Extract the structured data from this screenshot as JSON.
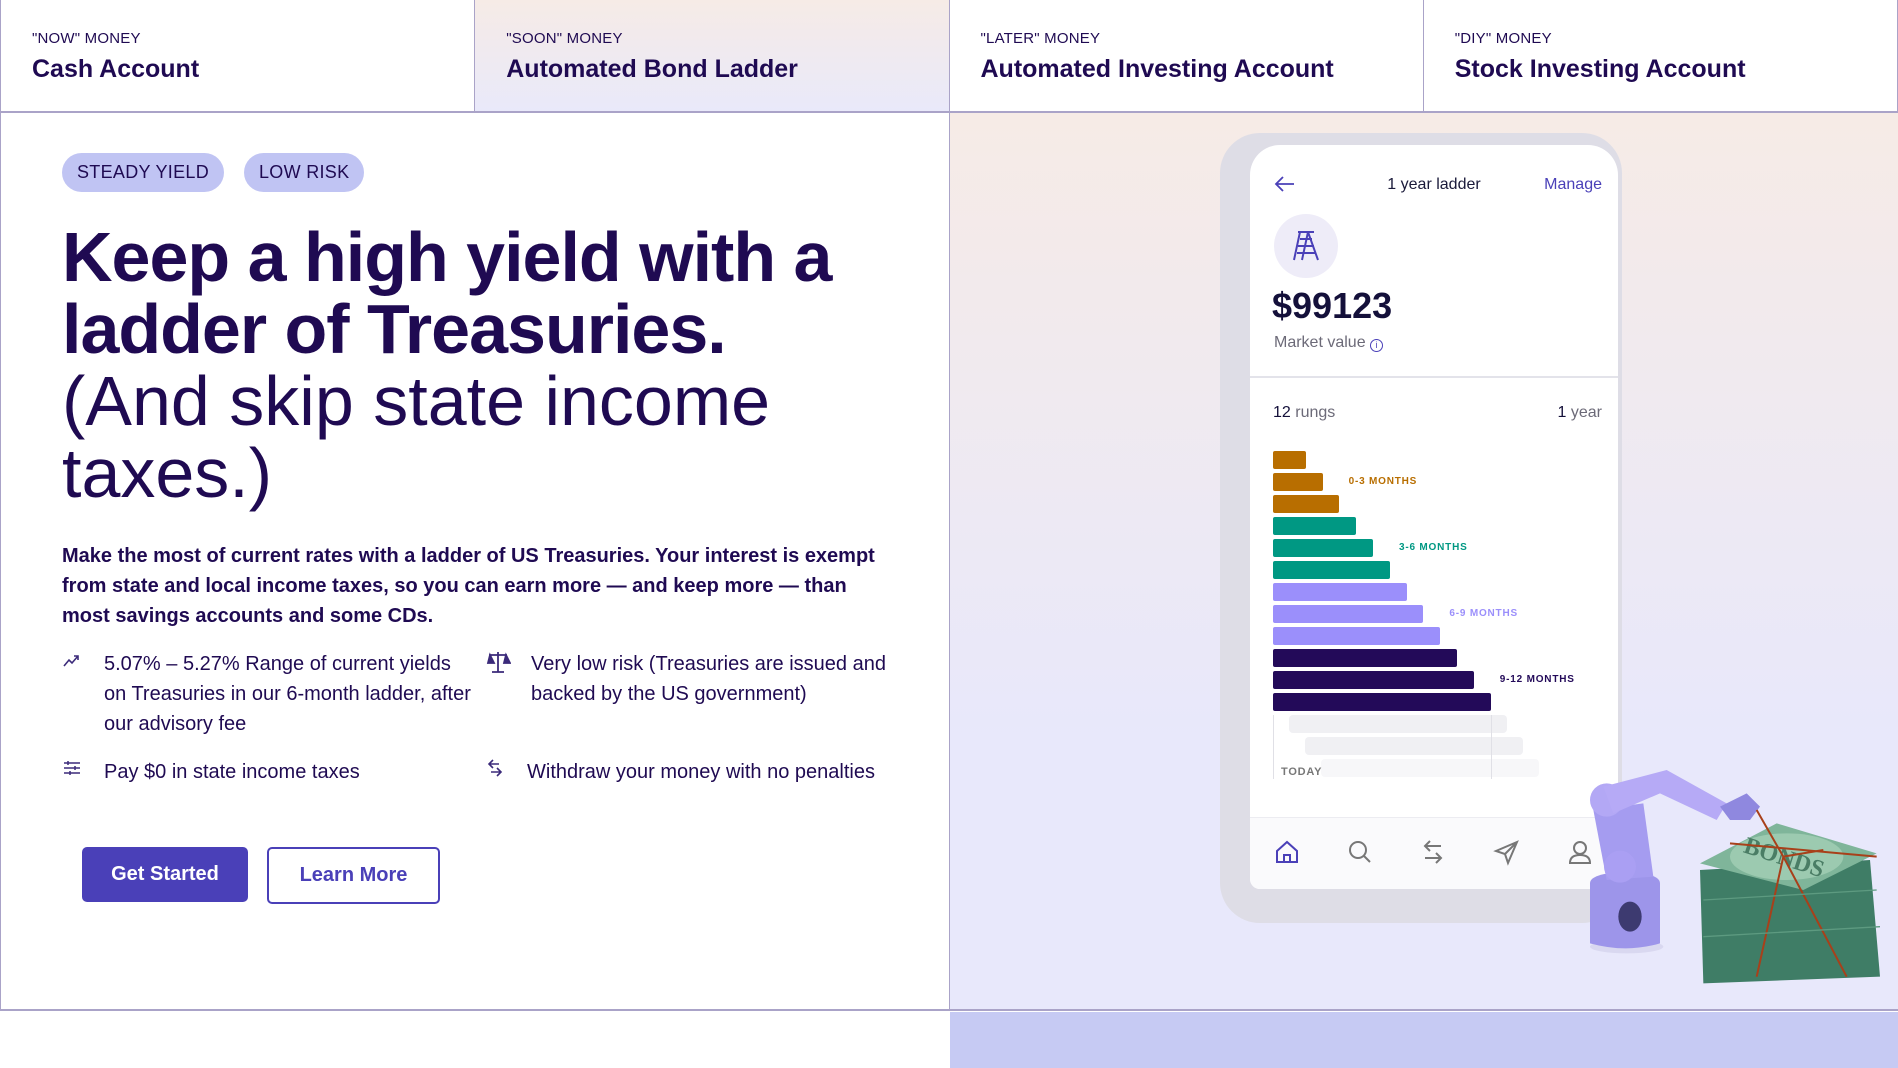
{
  "tabs": [
    {
      "sub": "\"NOW\" MONEY",
      "title": "Cash Account",
      "active": false
    },
    {
      "sub": "\"SOON\" MONEY",
      "title": "Automated Bond Ladder",
      "active": true
    },
    {
      "sub": "\"LATER\" MONEY",
      "title": "Automated Investing Account",
      "active": false
    },
    {
      "sub": "\"DIY\" MONEY",
      "title": "Stock Investing Account",
      "active": false
    }
  ],
  "hero": {
    "pills": [
      "STEADY YIELD",
      "LOW RISK"
    ],
    "headline_bold": "Keep a high yield with a ladder of Treasuries.",
    "headline_light": "(And skip state income taxes.)",
    "paragraph": "Make the most of current rates with a ladder of US Treasuries. Your interest is exempt from state and local income taxes, so you can earn more — and keep more — than most savings accounts and some CDs.",
    "features": [
      {
        "icon": "trend-up-icon",
        "text": "5.07% – 5.27% Range of current yields on Treasuries in our 6-month ladder, after our advisory fee"
      },
      {
        "icon": "scale-icon",
        "text": "Very low risk (Treasuries are issued and backed by the US government)"
      },
      {
        "icon": "sliders-icon",
        "text": "Pay $0 in state income taxes"
      },
      {
        "icon": "swap-arrows-icon",
        "text": "Withdraw your money with no penalties"
      }
    ],
    "get_started": "Get Started",
    "learn_more": "Learn More"
  },
  "phone": {
    "title": "1 year ladder",
    "manage": "Manage",
    "value": "$99123",
    "value_label": "Market value",
    "rungs_count": "12",
    "rungs_label": "rungs",
    "term_count": "1",
    "term_label": "year",
    "today": "TODAY",
    "nav": [
      "home-icon",
      "search-icon",
      "transfer-icon",
      "send-icon",
      "profile-icon"
    ]
  },
  "illustration_lettering": "BONDS",
  "colors": {
    "accent": "#4a40b8",
    "navy": "#1f0a52",
    "gold": "#b86e00",
    "teal": "#009883",
    "lavender": "#9b8ffb",
    "dark": "#230a59",
    "footer": "#c6caf3"
  },
  "chart_data": {
    "type": "bar",
    "orientation": "horizontal",
    "categories": [
      "1",
      "2",
      "3",
      "4",
      "5",
      "6",
      "7",
      "8",
      "9",
      "10",
      "11",
      "12"
    ],
    "values": [
      1,
      2,
      3,
      4,
      5,
      6,
      7,
      8,
      9,
      10,
      11,
      12
    ],
    "groups": [
      {
        "name": "0-3 MONTHS",
        "color": "#b86e00",
        "rungs": [
          1,
          2,
          3
        ]
      },
      {
        "name": "3-6 MONTHS",
        "color": "#009883",
        "rungs": [
          4,
          5,
          6
        ]
      },
      {
        "name": "6-9 MONTHS",
        "color": "#9b8ffb",
        "rungs": [
          7,
          8,
          9
        ]
      },
      {
        "name": "9-12 MONTHS",
        "color": "#230a59",
        "rungs": [
          10,
          11,
          12
        ]
      }
    ]
  }
}
